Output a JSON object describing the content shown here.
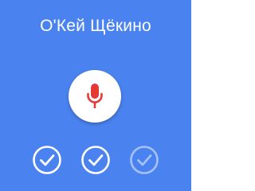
{
  "title": "О'Кей Щёкино",
  "microphone": {
    "icon": "microphone-icon",
    "icon_color": "#e53935"
  },
  "background_color": "#4a83ef",
  "progress_checks": [
    {
      "icon": "check-circle-icon",
      "state": "completed"
    },
    {
      "icon": "check-circle-icon",
      "state": "completed"
    },
    {
      "icon": "check-circle-icon",
      "state": "pending"
    }
  ],
  "progress": {
    "completed": 2,
    "total": 3
  }
}
